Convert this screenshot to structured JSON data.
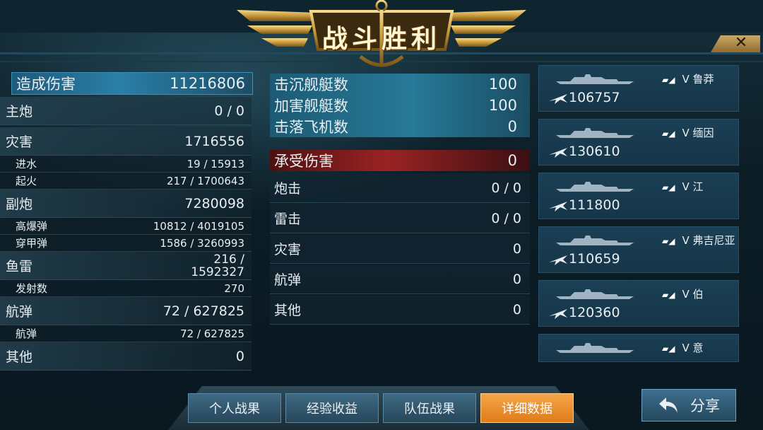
{
  "header": {
    "title": "战斗胜利",
    "close_label": "✕"
  },
  "damage": {
    "header_label": "造成伤害",
    "header_value": "11216806",
    "rows": [
      {
        "label": "主炮",
        "value": "0 / 0",
        "type": "main"
      },
      {
        "label": "灾害",
        "value": "1716556",
        "type": "main"
      },
      {
        "label": "进水",
        "value": "19 / 15913",
        "type": "sub"
      },
      {
        "label": "起火",
        "value": "217 / 1700643",
        "type": "sub"
      },
      {
        "label": "副炮",
        "value": "7280098",
        "type": "main"
      },
      {
        "label": "高爆弹",
        "value": "10812 / 4019105",
        "type": "sub"
      },
      {
        "label": "穿甲弹",
        "value": "1586 / 3260993",
        "type": "sub"
      },
      {
        "label": "鱼雷",
        "value": "216 / 1592327",
        "value_line1": "216 /",
        "value_line2": "1592327",
        "type": "main"
      },
      {
        "label": "发射数",
        "value": "270",
        "type": "sub"
      },
      {
        "label": "航弹",
        "value": "72 / 627825",
        "type": "main"
      },
      {
        "label": "航弹",
        "value": "72 / 627825",
        "type": "sub"
      },
      {
        "label": "其他",
        "value": "0",
        "type": "main"
      }
    ]
  },
  "kills": [
    {
      "label": "击沉舰艇数",
      "value": "100"
    },
    {
      "label": "加害舰艇数",
      "value": "100"
    },
    {
      "label": "击落飞机数",
      "value": "0"
    }
  ],
  "received": {
    "header_label": "承受伤害",
    "header_value": "0",
    "rows": [
      {
        "label": "炮击",
        "value": "0 / 0"
      },
      {
        "label": "雷击",
        "value": "0 / 0"
      },
      {
        "label": "灾害",
        "value": "0"
      },
      {
        "label": "航弹",
        "value": "0"
      },
      {
        "label": "其他",
        "value": "0"
      }
    ]
  },
  "ships": [
    {
      "tier": "V",
      "name": "鲁莽",
      "score": "106757"
    },
    {
      "tier": "V",
      "name": "缅因",
      "score": "130610"
    },
    {
      "tier": "V",
      "name": "江",
      "score": "111800"
    },
    {
      "tier": "V",
      "name": "弗吉尼亚",
      "score": "110659"
    },
    {
      "tier": "V",
      "name": "伯",
      "score": "120360"
    },
    {
      "tier": "V",
      "name": "意",
      "score": ""
    }
  ],
  "tabs": [
    {
      "label": "个人战果",
      "active": false
    },
    {
      "label": "经验收益",
      "active": false
    },
    {
      "label": "队伍战果",
      "active": false
    },
    {
      "label": "详细数据",
      "active": true
    }
  ],
  "share": {
    "label": "分享"
  },
  "colors": {
    "accent_gold": "#e0b650",
    "active_tab": "#e07b16",
    "damage_header": "#2a7fa8",
    "received_header": "#9a2323"
  }
}
